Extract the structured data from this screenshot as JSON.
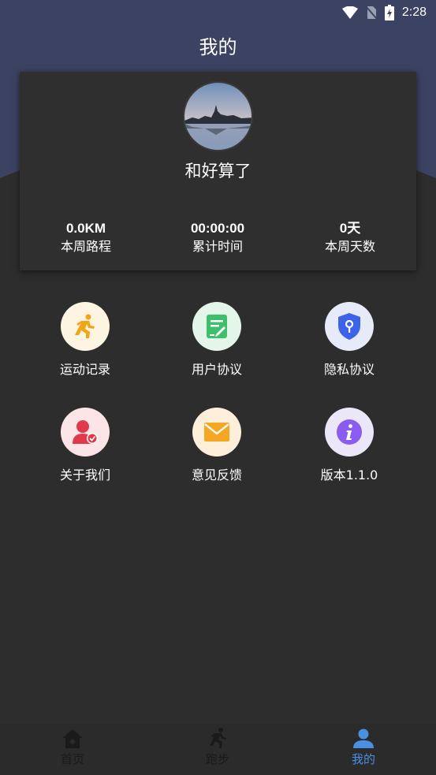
{
  "status_bar": {
    "time": "2:28"
  },
  "header": {
    "title": "我的"
  },
  "profile": {
    "username": "和好算了",
    "stats": [
      {
        "value": "0.0KM",
        "label": "本周路程"
      },
      {
        "value": "00:00:00",
        "label": "累计时间"
      },
      {
        "value": "0天",
        "label": "本周天数"
      }
    ]
  },
  "menu": [
    {
      "label": "运动记录",
      "icon": "running-icon"
    },
    {
      "label": "用户协议",
      "icon": "document-edit-icon"
    },
    {
      "label": "隐私协议",
      "icon": "shield-lock-icon"
    },
    {
      "label": "关于我们",
      "icon": "user-check-icon"
    },
    {
      "label": "意见反馈",
      "icon": "envelope-icon"
    },
    {
      "label": "版本1.1.0",
      "icon": "info-icon"
    }
  ],
  "bottom_nav": [
    {
      "label": "首页",
      "icon": "home-icon"
    },
    {
      "label": "跑步",
      "icon": "runner-icon"
    },
    {
      "label": "我的",
      "icon": "user-icon",
      "active": true
    }
  ],
  "colors": {
    "header": "#3c4261",
    "background": "#2d2d2d",
    "active_tab": "#4a90e2"
  }
}
